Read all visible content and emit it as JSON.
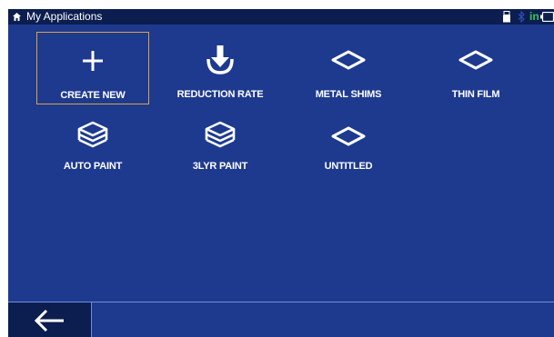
{
  "header": {
    "title": "My Applications",
    "home_icon": "home-icon",
    "status": {
      "usb_icon": "usb-icon",
      "bluetooth_icon": "bluetooth-icon",
      "input_indicator": "in",
      "battery_icon": "battery-icon"
    }
  },
  "tiles": [
    {
      "label": "CREATE NEW",
      "icon": "plus-icon",
      "selected": true
    },
    {
      "label": "REDUCTION RATE",
      "icon": "reduction-arrow-icon"
    },
    {
      "label": "METAL SHIMS",
      "icon": "shim-icon"
    },
    {
      "label": "THIN FILM",
      "icon": "shim-icon"
    },
    {
      "label": "AUTO PAINT",
      "icon": "layers-icon"
    },
    {
      "label": "3LYR PAINT",
      "icon": "layers-icon"
    },
    {
      "label": "UNTITLED",
      "icon": "shim-icon"
    }
  ],
  "footer": {
    "back_icon": "back-arrow-icon"
  },
  "colors": {
    "background": "#1e3a8f",
    "statusbar": "#0c1d4f",
    "selection_border": "#d9a441",
    "indicator_green": "#34c759"
  }
}
